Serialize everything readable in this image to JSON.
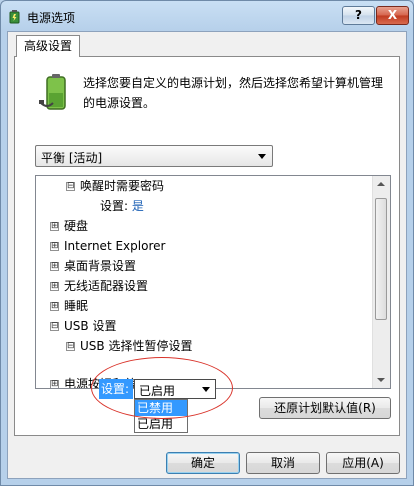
{
  "window": {
    "title": "电源选项",
    "help_label": "?",
    "close_label": "X"
  },
  "tab": {
    "label": "高级设置"
  },
  "intro_text": "选择您要自定义的电源计划，然后选择您希望计算机管理的电源设置。",
  "plan_select": {
    "value": "平衡 [活动]"
  },
  "tree": {
    "items": [
      {
        "expander": "⊟",
        "label": "唤醒时需要密码"
      },
      {
        "expander": "",
        "label": "设置:",
        "value": "是"
      },
      {
        "expander": "⊞",
        "label": "硬盘"
      },
      {
        "expander": "⊞",
        "label": "Internet Explorer"
      },
      {
        "expander": "⊞",
        "label": "桌面背景设置"
      },
      {
        "expander": "⊞",
        "label": "无线适配器设置"
      },
      {
        "expander": "⊞",
        "label": "睡眠"
      },
      {
        "expander": "⊟",
        "label": "USB 设置"
      },
      {
        "expander": "⊟",
        "label": "USB 选择性暂停设置"
      },
      {
        "expander": "⊞",
        "label": "电源按钮和盖"
      }
    ]
  },
  "inline_setting": {
    "label": "设置:",
    "value": "已启用",
    "options": [
      "已禁用",
      "已启用"
    ],
    "selected_option": "已禁用"
  },
  "buttons": {
    "restore": "还原计划默认值(R)",
    "ok": "确定",
    "cancel": "取消",
    "apply": "应用(A)"
  },
  "colors": {
    "accent": "#3399ff",
    "link_value": "#1a5fb4",
    "annotation": "#d9342b"
  }
}
